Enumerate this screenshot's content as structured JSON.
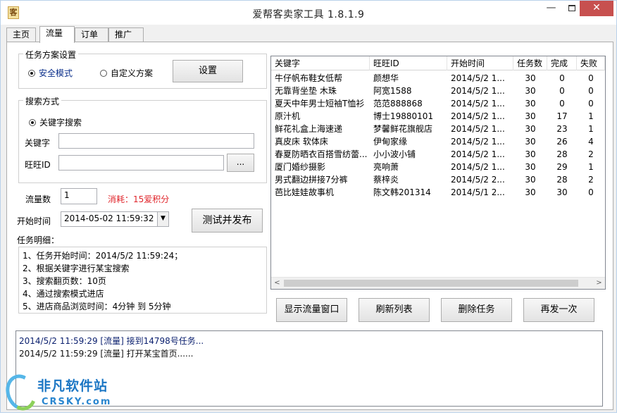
{
  "window": {
    "title": "爱帮客卖家工具 1.8.1.9",
    "icon_name": "app-seal-icon",
    "icon_glyph": "客",
    "controls": {
      "minimize": "—",
      "close": "✕"
    }
  },
  "tabs": [
    {
      "label": "主页"
    },
    {
      "label": "流量"
    },
    {
      "label": "订单"
    },
    {
      "label": "推广"
    }
  ],
  "task_scheme": {
    "title": "任务方案设置",
    "options": [
      "安全模式",
      "自定义方案"
    ],
    "selected": "安全模式",
    "settings_button": "设置"
  },
  "search_mode": {
    "title": "搜索方式",
    "option": "关键字搜索",
    "keyword_label": "关键字",
    "keyword_value": "",
    "wangwang_label": "旺旺ID",
    "wangwang_value": "",
    "browse_button": "..."
  },
  "traffic": {
    "count_label": "流量数",
    "count_value": "1",
    "cost_text": "消耗：15爱积分"
  },
  "start_time": {
    "label": "开始时间",
    "value": "2014-05-02 11:59:32",
    "arrow": "▼"
  },
  "test_publish_button": "测试并发布",
  "task_detail": {
    "title": "任务明细：",
    "lines": [
      "1、任务开始时间：2014/5/2 11:59:24；",
      "2、根据关键字进行某宝搜索",
      "3、搜索翻页数：10页",
      "4、通过搜索模式进店",
      "5、进店商品浏览时间：4分钟 到 5分钟"
    ]
  },
  "task_list": {
    "columns": [
      "关键字",
      "旺旺ID",
      "开始时间",
      "任务数",
      "完成",
      "失败"
    ],
    "rows": [
      [
        "牛仔帆布鞋女低帮",
        "颜想华",
        "2014/5/2 1...",
        "30",
        "0",
        "0"
      ],
      [
        "无靠背坐垫 木珠",
        "阿宽1588",
        "2014/5/2 1...",
        "30",
        "0",
        "0"
      ],
      [
        "夏天中年男士短袖T恤衫",
        "范范888868",
        "2014/5/2 1...",
        "30",
        "0",
        "0"
      ],
      [
        "原汁机",
        "博士19880101",
        "2014/5/2 1...",
        "30",
        "17",
        "1"
      ],
      [
        "鲜花礼盒上海速递",
        "梦馨鲜花旗舰店",
        "2014/5/2 1...",
        "30",
        "23",
        "1"
      ],
      [
        "真皮床 软体床",
        "伊甸家缘",
        "2014/5/2 1...",
        "30",
        "26",
        "4"
      ],
      [
        "春夏防晒衣百搭雪纺蕾...",
        "小小波小铺",
        "2014/5/2 1...",
        "30",
        "28",
        "2"
      ],
      [
        "厦门婚纱摄影",
        "亮响萧",
        "2014/5/2 1...",
        "30",
        "29",
        "1"
      ],
      [
        "男式翻边拼接7分裤",
        "蔡梓炎",
        "2014/5/2 2...",
        "30",
        "28",
        "2"
      ],
      [
        "芭比娃娃故事机",
        "陈文韩201314",
        "2014/5/1 2...",
        "30",
        "30",
        "0"
      ]
    ],
    "scroll_left": "<",
    "scroll_right": ">"
  },
  "actions": {
    "show_window": "显示流量窗口",
    "refresh": "刷新列表",
    "delete": "删除任务",
    "republish": "再发一次"
  },
  "log": [
    "2014/5/2 11:59:29 [流量] 接到14798号任务...",
    "2014/5/2 11:59:29 [流量] 打开某宝首页......"
  ],
  "watermark": {
    "name": "非凡软件站",
    "domain": "CRSKY.com"
  },
  "colors": {
    "accent_blue": "#0a2e8a",
    "warning_red": "#e0242a",
    "close_button": "#c7504f"
  }
}
